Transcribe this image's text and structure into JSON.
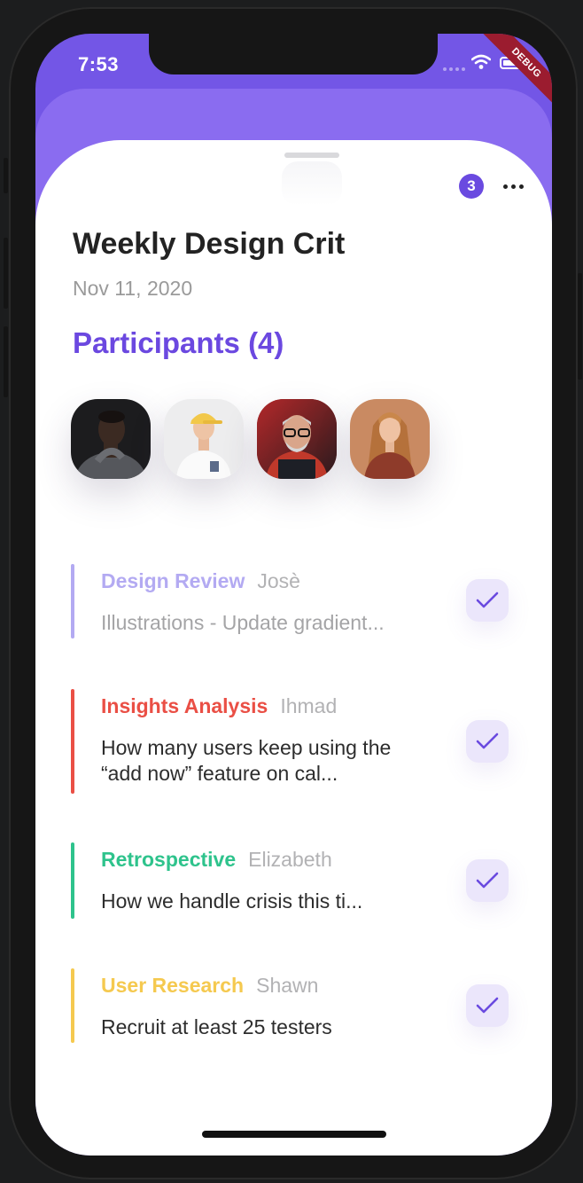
{
  "status_bar": {
    "time": "7:53",
    "debug_label": "DEBUG"
  },
  "header": {
    "notification_count": "3",
    "more_icon": "more-horizontal-icon"
  },
  "meeting": {
    "title": "Weekly Design Crit",
    "date": "Nov 11, 2020",
    "participants_label": "Participants (4)"
  },
  "colors": {
    "accent": "#6b48e0",
    "header_bg": "#7356e6",
    "design_review": "#b3aaf2",
    "insights": "#ea4f45",
    "retrospective": "#2ec38c",
    "user_research": "#f5c94f"
  },
  "tasks": [
    {
      "category": "Design Review",
      "assignee": "Josè",
      "description": "Illustrations - Update gradient...",
      "color": "#b3aaf2",
      "dimmed": true
    },
    {
      "category": "Insights Analysis",
      "assignee": "Ihmad",
      "description": "How many users keep using the “add now” feature on cal...",
      "color": "#ea4f45",
      "dimmed": false
    },
    {
      "category": "Retrospective",
      "assignee": "Elizabeth",
      "description": "How we handle crisis this ti...",
      "color": "#2ec38c",
      "dimmed": false
    },
    {
      "category": "User Research",
      "assignee": "Shawn",
      "description": "Recruit at least 25 testers",
      "color": "#f5c94f",
      "dimmed": false
    }
  ]
}
